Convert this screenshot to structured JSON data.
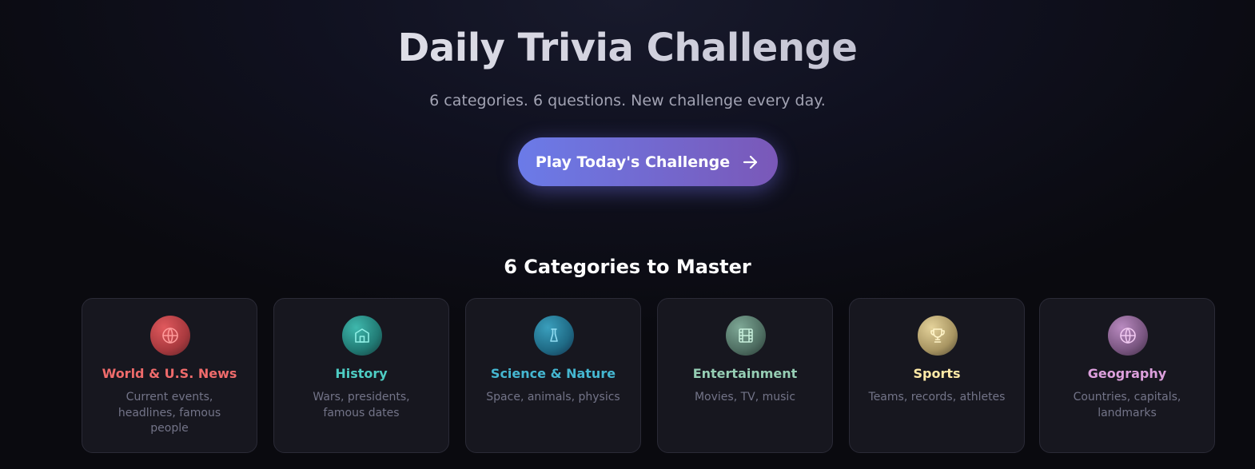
{
  "hero": {
    "title": "Daily Trivia Challenge",
    "subtitle": "6 categories. 6 questions. New challenge every day.",
    "cta_label": "Play Today's Challenge",
    "cta_icon": "arrow-right-icon"
  },
  "categories_section": {
    "title": "6 Categories to Master",
    "items": [
      {
        "name": "World & U.S. News",
        "description": "Current events, headlines, famous people",
        "icon": "globe-icon",
        "accent": "#ef6b6b"
      },
      {
        "name": "History",
        "description": "Wars, presidents, famous dates",
        "icon": "landmark-icon",
        "accent": "#4ecdc4"
      },
      {
        "name": "Science & Nature",
        "description": "Space, animals, physics",
        "icon": "flask-icon",
        "accent": "#45b7d1"
      },
      {
        "name": "Entertainment",
        "description": "Movies, TV, music",
        "icon": "film-icon",
        "accent": "#96ceb4"
      },
      {
        "name": "Sports",
        "description": "Teams, records, athletes",
        "icon": "trophy-icon",
        "accent": "#ffeaa7"
      },
      {
        "name": "Geography",
        "description": "Countries, capitals, landmarks",
        "icon": "globe-icon",
        "accent": "#dda0dd"
      }
    ]
  },
  "colors": {
    "background": "#0a0a0f",
    "card_background": "#17171f",
    "cta_gradient_start": "#6b7be8",
    "cta_gradient_end": "#7a58b8"
  }
}
